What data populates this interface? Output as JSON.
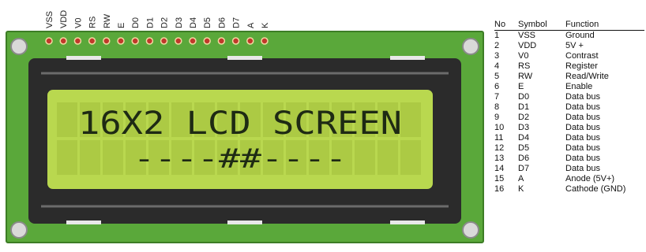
{
  "pin_labels": [
    "VSS",
    "VDD",
    "V0",
    "RS",
    "RW",
    "E",
    "D0",
    "D1",
    "D2",
    "D3",
    "D4",
    "D5",
    "D6",
    "D7",
    "A",
    "K"
  ],
  "display": {
    "line1": "16X2 LCD SCREEN",
    "line2": "----##----"
  },
  "table": {
    "headers": [
      "No",
      "Symbol",
      "Function"
    ],
    "rows": [
      {
        "no": "1",
        "symbol": "VSS",
        "function": "Ground"
      },
      {
        "no": "2",
        "symbol": "VDD",
        "function": "5V +"
      },
      {
        "no": "3",
        "symbol": "V0",
        "function": "Contrast"
      },
      {
        "no": "4",
        "symbol": "RS",
        "function": "Register"
      },
      {
        "no": "5",
        "symbol": "RW",
        "function": "Read/Write"
      },
      {
        "no": "6",
        "symbol": "E",
        "function": "Enable"
      },
      {
        "no": "7",
        "symbol": "D0",
        "function": "Data bus"
      },
      {
        "no": "8",
        "symbol": "D1",
        "function": "Data bus"
      },
      {
        "no": "9",
        "symbol": "D2",
        "function": "Data bus"
      },
      {
        "no": "10",
        "symbol": "D3",
        "function": "Data bus"
      },
      {
        "no": "11",
        "symbol": "D4",
        "function": "Data bus"
      },
      {
        "no": "12",
        "symbol": "D5",
        "function": "Data bus"
      },
      {
        "no": "13",
        "symbol": "D6",
        "function": "Data bus"
      },
      {
        "no": "14",
        "symbol": "D7",
        "function": "Data bus"
      },
      {
        "no": "15",
        "symbol": "A",
        "function": "Anode (5V+)"
      },
      {
        "no": "16",
        "symbol": "K",
        "function": "Cathode (GND)"
      }
    ]
  },
  "colors": {
    "pcb": "#5aa83a",
    "pcb_border": "#3d7d25",
    "bezel": "#2b2b2b",
    "lcd_screen": "#b9d84f",
    "lcd_text": "#1e2a14",
    "pin_hole": "#c0392b",
    "mount_hole": "#d9d9d9"
  }
}
